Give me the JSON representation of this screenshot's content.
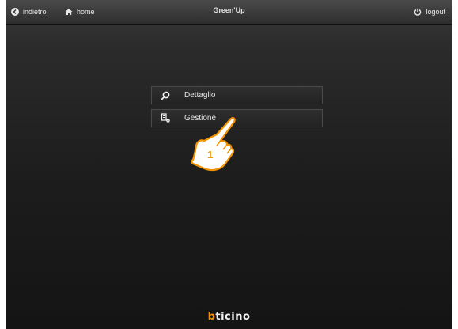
{
  "topbar": {
    "back_label": "indietro",
    "home_label": "home",
    "title": "Green'Up",
    "logout_label": "logout"
  },
  "menu": {
    "items": [
      {
        "label": "Dettaglio",
        "icon": "search-icon"
      },
      {
        "label": "Gestione",
        "icon": "edit-settings-icon"
      }
    ]
  },
  "callout": {
    "number": "1",
    "icon": "hand-pointer-icon"
  },
  "footer": {
    "logo_b": "b",
    "logo_rest": "ticino"
  },
  "colors": {
    "brand_orange": "#f29200",
    "background_dark": "#1d1d1d",
    "text_light": "#e6e6e6"
  }
}
